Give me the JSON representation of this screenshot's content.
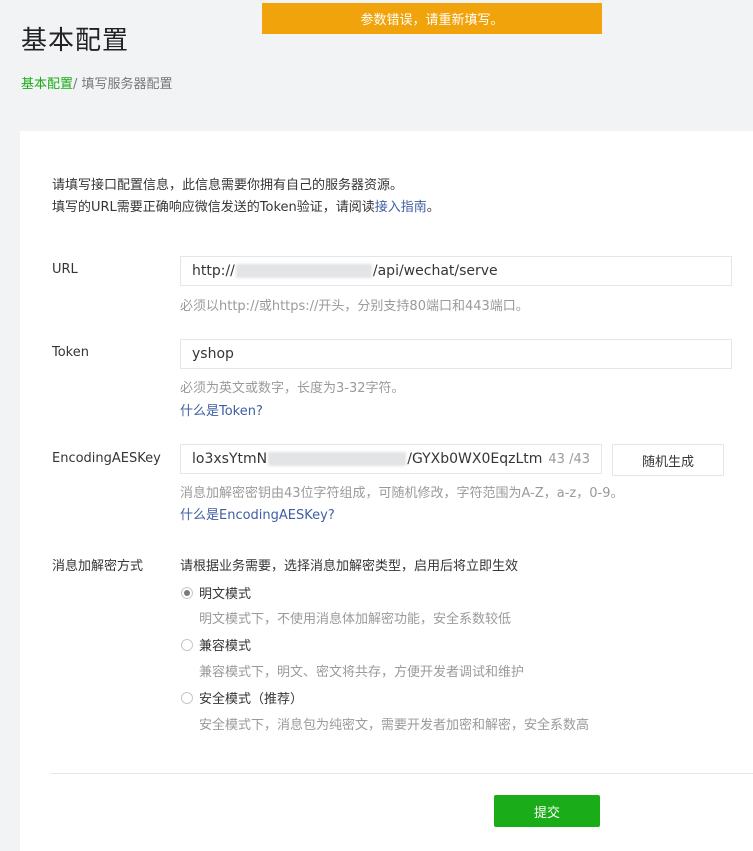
{
  "toast": {
    "message": "参数错误，请重新填写。"
  },
  "page": {
    "title": "基本配置"
  },
  "breadcrumb": {
    "link": "基本配置",
    "separator": "/ ",
    "current": "填写服务器配置"
  },
  "intro": {
    "line1": "请填写接口配置信息，此信息需要你拥有自己的服务器资源。",
    "line2_prefix": "填写的URL需要正确响应微信发送的Token验证，请阅读",
    "line2_link": "接入指南",
    "line2_suffix": "。"
  },
  "url": {
    "label": "URL",
    "value_prefix": "http://",
    "value_suffix": "/api/wechat/serve",
    "hint": "必须以http://或https://开头，分别支持80端口和443端口。"
  },
  "token": {
    "label": "Token",
    "value": "yshop",
    "hint": "必须为英文或数字，长度为3-32字符。",
    "help": "什么是Token?"
  },
  "aes": {
    "label": "EncodingAESKey",
    "value_prefix": "lo3xsYtmN",
    "value_suffix": "/GYXb0WX0EqzLtm",
    "counter": "43 /43",
    "random_button": "随机生成",
    "hint": "消息加解密密钥由43位字符组成，可随机修改，字符范围为A-Z，a-z，0-9。",
    "help": "什么是EncodingAESKey?"
  },
  "encryption": {
    "label": "消息加解密方式",
    "description": "请根据业务需要，选择消息加解密类型，启用后将立即生效",
    "options": [
      {
        "label": "明文模式",
        "desc": "明文模式下，不使用消息体加解密功能，安全系数较低",
        "checked": true
      },
      {
        "label": "兼容模式",
        "desc": "兼容模式下，明文、密文将共存，方便开发者调试和维护",
        "checked": false
      },
      {
        "label": "安全模式（推荐）",
        "desc": "安全模式下，消息包为纯密文，需要开发者加密和解密，安全系数高",
        "checked": false
      }
    ]
  },
  "submit": {
    "label": "提交"
  },
  "colors": {
    "brand": "#1aad19",
    "toast": "#f0a30a",
    "link": "#3f5ea3"
  }
}
